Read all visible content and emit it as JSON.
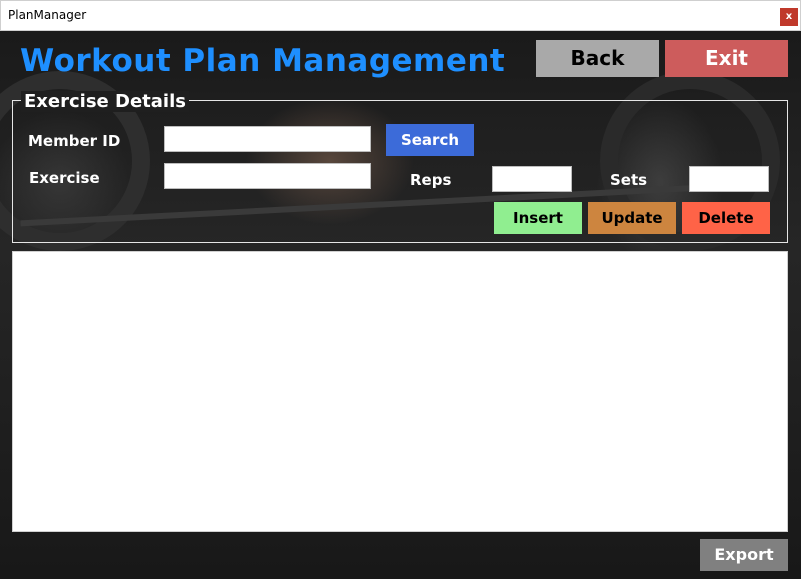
{
  "window": {
    "title": "PlanManager",
    "close_label": "x"
  },
  "header": {
    "title": "Workout Plan Management",
    "back_label": "Back",
    "exit_label": "Exit"
  },
  "exercise_details": {
    "legend": "Exercise Details",
    "member_id_label": "Member ID",
    "member_id_value": "",
    "search_label": "Search",
    "exercise_label": "Exercise",
    "exercise_value": "",
    "reps_label": "Reps",
    "reps_value": "",
    "sets_label": "Sets",
    "sets_value": "",
    "insert_label": "Insert",
    "update_label": "Update",
    "delete_label": "Delete"
  },
  "footer": {
    "export_label": "Export"
  },
  "colors": {
    "title_blue": "#1e8fff",
    "back": "#a9a9a9",
    "exit": "#cd5c5c",
    "search": "#3c6bd9",
    "insert": "#90ee90",
    "update": "#cd853f",
    "delete": "#ff6347",
    "export": "#808080",
    "close": "#c0392b"
  }
}
